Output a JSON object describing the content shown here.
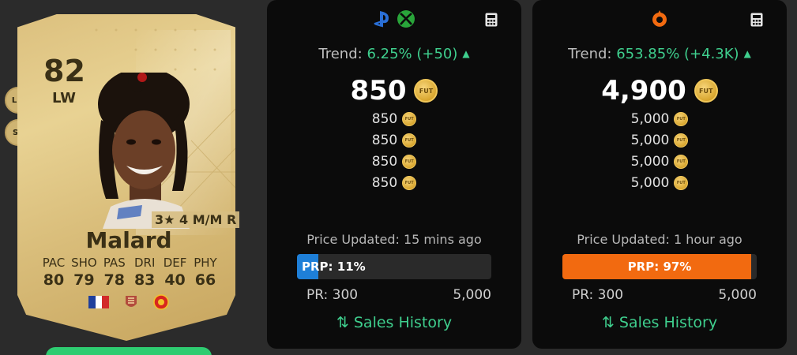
{
  "card": {
    "rating": "82",
    "position": "LW",
    "alt_positions": [
      "LM",
      "ST"
    ],
    "skills": "3★ 4 M/M R",
    "name": "Malard",
    "stat_labels": [
      "PAC",
      "SHO",
      "PAS",
      "DRI",
      "DEF",
      "PHY"
    ],
    "stat_values": [
      "80",
      "79",
      "78",
      "83",
      "40",
      "66"
    ],
    "nation": "france-flag",
    "league": "league-badge",
    "club": "manchester-united-crest"
  },
  "console": {
    "platform_icons": [
      "playstation-icon",
      "xbox-icon"
    ],
    "trend_label": "Trend:",
    "trend_value": "6.25% (+50)",
    "price": "850",
    "recent_prices": [
      "850",
      "850",
      "850",
      "850"
    ],
    "updated": "Price Updated: 15 mins ago",
    "prp_label": "PRP:",
    "prp_value": "11%",
    "prp_fraction": 0.11,
    "pr_min": "PR: 300",
    "pr_max": "5,000",
    "sales_history": "Sales History",
    "accent": "#1e7fd8"
  },
  "pc": {
    "platform_icons": [
      "origin-icon"
    ],
    "trend_label": "Trend:",
    "trend_value": "653.85% (+4.3K)",
    "price": "4,900",
    "recent_prices": [
      "5,000",
      "5,000",
      "5,000",
      "5,000"
    ],
    "updated": "Price Updated: 1 hour ago",
    "prp_label": "PRP:",
    "prp_value": "97%",
    "prp_fraction": 0.97,
    "pr_min": "PR: 300",
    "pr_max": "5,000",
    "sales_history": "Sales History",
    "accent": "#f26a10"
  },
  "coin_label": "FUT",
  "colors": {
    "trend_green": "#3fcf8e",
    "panel_bg": "#0b0b0b"
  }
}
